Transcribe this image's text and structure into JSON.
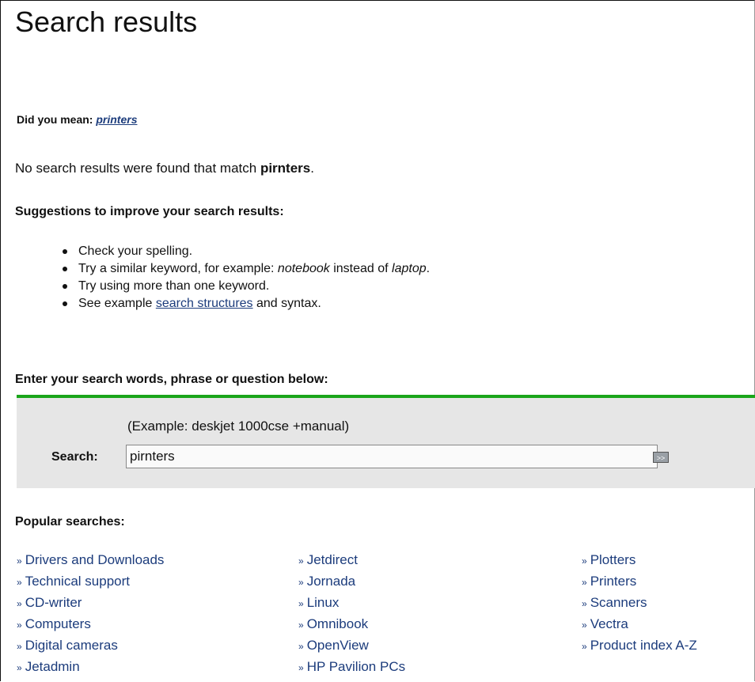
{
  "page": {
    "title": "Search results",
    "did_you_mean_label": "Did you mean:",
    "did_you_mean_link": "printers",
    "no_results_prefix": "No search results were found that match ",
    "no_results_term": "pirnters",
    "no_results_suffix": "."
  },
  "suggestions": {
    "heading": "Suggestions to improve your search results:",
    "items": [
      {
        "text": "Check your spelling."
      },
      {
        "prefix": "Try a similar keyword, for example: ",
        "em1": "notebook",
        "mid": " instead of ",
        "em2": "laptop",
        "suffix": "."
      },
      {
        "text": "Try using more than one keyword."
      },
      {
        "prefix": "See example ",
        "link": "search structures",
        "suffix": " and syntax."
      }
    ]
  },
  "search": {
    "heading": "Enter your search words, phrase or question below:",
    "example": "(Example: deskjet 1000cse +manual)",
    "label": "Search:",
    "value": "pirnters",
    "button_label": ">>",
    "accent_color": "#1aa51a"
  },
  "popular": {
    "heading": "Popular searches:",
    "bullet": "»",
    "columns": [
      [
        "Drivers and Downloads",
        "Technical support",
        "CD-writer",
        "Computers",
        "Digital cameras",
        "Jetadmin"
      ],
      [
        "Jetdirect",
        "Jornada",
        "Linux",
        "Omnibook",
        "OpenView",
        "HP Pavilion PCs"
      ],
      [
        "Plotters",
        "Printers",
        "Scanners",
        "Vectra",
        "Product index A-Z"
      ]
    ]
  }
}
